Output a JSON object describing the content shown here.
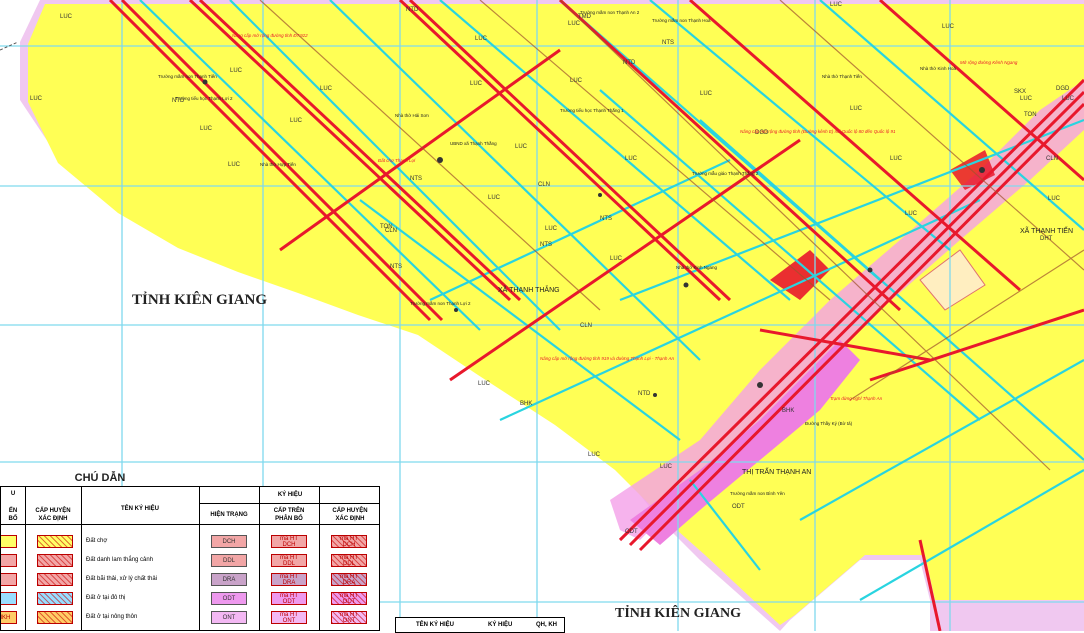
{
  "map": {
    "provinces": [
      "TỈNH KIÊN GIANG",
      "TỈNH KIÊN GIANG"
    ],
    "communes": [
      "XÃ THẠNH THẮNG",
      "XÃ THẠNH TIẾN",
      "THỊ TRẤN THẠNH AN"
    ],
    "land_codes": [
      "LUC",
      "LUC",
      "LUC",
      "LUC",
      "LUC",
      "LUC",
      "LUC",
      "LUC",
      "LUC",
      "LUC",
      "LUC",
      "LUC",
      "LUC",
      "LUC",
      "LUC",
      "LUC",
      "LUC",
      "LUC",
      "LUC",
      "LUC",
      "LUC",
      "LUC",
      "LUC",
      "LUC",
      "LUC",
      "LUC",
      "LUC",
      "LUC",
      "NTS",
      "NTS",
      "NTS",
      "NTS",
      "NTS",
      "NTD",
      "NTD",
      "NTD",
      "NTD",
      "CLN",
      "CLN",
      "CLN",
      "CLN",
      "TON",
      "TON",
      "BHK",
      "BHK",
      "SKX",
      "DGD",
      "DGD",
      "ODT",
      "ODT",
      "NKH",
      "TMD",
      "DHT"
    ],
    "place_notes": [
      "Trường mầm non Thạnh Tiến",
      "Trường tiểu học Thạnh Lợi 2",
      "Nhà thờ Hải Sơn",
      "Nhà thờ Hợp Tiến",
      "Trường tiểu học Thạnh Thắng 1",
      "UBND xã Thạnh Thắng",
      "Nhà thờ Kinh Ngang",
      "Trường mầm non Thạnh Lợi 2",
      "Trường mầm non Thạnh An 2",
      "Trường mầm non Thạnh Hoà",
      "Nhà thờ Thạnh Tiến",
      "Trường mẫu giáo Thạnh Thắng 2",
      "Trường mầm non Bình Yên",
      "Nhà thờ Kinh Hoà",
      "Đường Thầy Ký (Bờ tả)"
    ],
    "plan_notes": [
      "Nâng cấp mở rộng đường tỉnh ĐT.922",
      "Nâng cấp mở rộng đường tỉnh (Đường kênh E) nối Quốc lộ 80 đến Quốc lộ 91",
      "Nâng cấp mở rộng đường tỉnh 919 và đường Thạnh Lợi - Thạnh An",
      "Mở rộng đường Kênh Ngang",
      "Trạm dừng nghỉ Thạnh An",
      "Đất chợ Thạnh Lợi"
    ]
  },
  "legend": {
    "title": "CHÚ DẪN",
    "header_top_left": "U",
    "header_left_cut": "ẾN\nBỔ",
    "header_district": "CẤP HUYỆN\nXÁC ĐỊNH",
    "header_name": "TÊN KÝ HIỆU",
    "header_symbol": "KÝ HIỆU",
    "header_current": "HIỆN TRẠNG",
    "header_upper": "CẤP TRÊN\nPHÂN BỔ",
    "header_district2": "CẤP HUYỆN\nXÁC ĐỊNH",
    "rows": [
      {
        "name": "Đất chợ",
        "code": "DCH",
        "upper": "mã HT\nDCH",
        "fill": "#f2a6a6"
      },
      {
        "name": "Đất danh lam thắng cảnh",
        "code": "DDL",
        "upper": "mã HT\nDDL",
        "fill": "#f2a6a6"
      },
      {
        "name": "Đất bãi thải, xử lý chất thải",
        "code": "DRA",
        "upper": "mã HT\nDRA",
        "fill": "#c9a3c9"
      },
      {
        "name": "Đất ở tại đô thị",
        "code": "ODT",
        "upper": "mã HT\nODT",
        "fill": "#ee99ee"
      },
      {
        "name": "Đất ở tại nông thôn",
        "code": "ONT",
        "upper": "mã HT\nONT",
        "fill": "#f3b8f3"
      }
    ],
    "left_swatch_fills": [
      "#ffff66",
      "#f2a6a6",
      "#f2a6a6",
      "#99ddff",
      "#ffcc66"
    ],
    "left_swatch_code_last": "NKH",
    "secondary": {
      "name": "TÊN KÝ HIỆU",
      "symbol": "KÝ HIỆU",
      "plan": "QH, KH"
    }
  },
  "colors": {
    "agri": "#ffff55",
    "urban": "#f4a0e8",
    "road_red": "#e8182c",
    "canal": "#29d4e0",
    "grid": "#7fd9ee",
    "boundary": "#f0c8f0"
  }
}
